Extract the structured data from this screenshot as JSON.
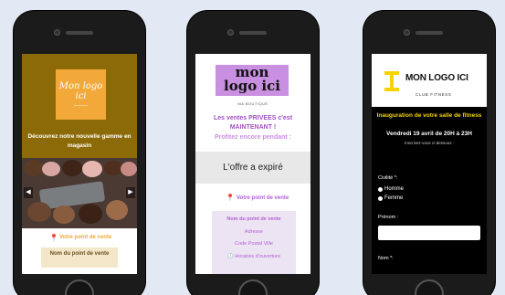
{
  "phone_1": {
    "logo_line1": "Mon logo",
    "logo_line2": "ici",
    "logo_sub": "———",
    "tagline": "Découvrez notre nouvelle gamme en magasin",
    "prev_arrow": "◀",
    "next_arrow": "▶",
    "pin_icon": "location-pin-icon",
    "point_link": "Votre point de vente",
    "box_title": "Nom du point de vente",
    "colors": {
      "header": "#8b6a07",
      "logo_bg": "#f2a93a",
      "accent": "#f2a93a"
    }
  },
  "phone_2": {
    "logo_line1": "mon",
    "logo_line2": "logo ici",
    "boutique": "MA BOUTIQUE",
    "sales_text": "Les ventes PRIVEES c'est MAINTENANT !",
    "profit_text": "Profitez encore pendant :",
    "expired_text": "L'offre a expiré",
    "pin_icon": "location-pin-icon",
    "point_link": "Votre point de vente",
    "box_lines": [
      "Nom du point de vente",
      "Adresse",
      "Code Postal Ville",
      "Horaires d'ouverture"
    ],
    "colors": {
      "logo_bg": "#c98fe0",
      "accent": "#b35fd6"
    }
  },
  "phone_3": {
    "logo": "MON LOGO ICI",
    "club": "CLUB FITNESS",
    "event_title": "Inauguration de votre salle de fitness",
    "event_date": "Vendredi 19 avril de 20H à 23H",
    "register": "Inscrivez-vous ci-dessous :",
    "civility_label": "Civilité *:",
    "option_1": "Homme",
    "option_2": "Femme",
    "firstname_label": "Prénom :",
    "lastname_label": "Nom *:",
    "colors": {
      "accent": "#f5d300",
      "icon": "#f5d300"
    }
  }
}
